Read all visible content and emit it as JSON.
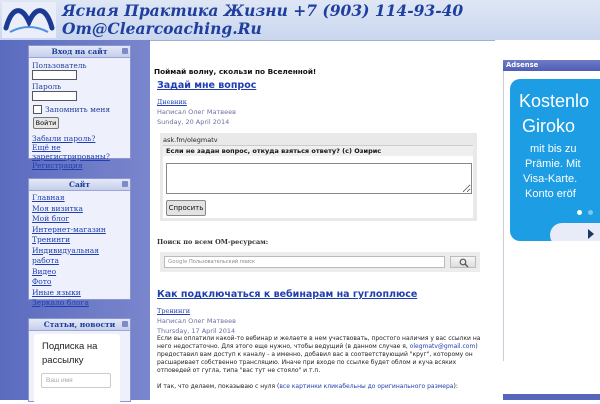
{
  "header": {
    "title_line1": "Ясная Практика Жизни +7 (903) 114-93-40",
    "title_line2": "Om@Clearcoaching.Ru"
  },
  "login": {
    "header": "Вход на сайт",
    "username_label": "Пользователь",
    "password_label": "Пароль",
    "remember_label": "Запомнить меня",
    "submit_label": "Войти",
    "forgot_label": "Забыли пароль?",
    "not_registered_label": "Ещё не зарегистрированы?",
    "register_label": "Регистрация"
  },
  "site_menu": {
    "header": "Сайт",
    "items": [
      "Главная",
      "Моя визитка",
      "Мой блог",
      "Интернет-магазин",
      "Тренинги",
      "Индивидуальная работа",
      "Видео",
      "Фото",
      "Иные языки",
      "Зеркало блога"
    ]
  },
  "news": {
    "header": "Статьи, новости",
    "subscribe_title": "Подписка на рассылку",
    "email_placeholder": "Ваш имя"
  },
  "main": {
    "slogan": "Поймай волну, скользи по Вселенной!",
    "post1": {
      "title": "Задай мне вопрос",
      "category": "Дневник",
      "author": "Написал Олег Матвеев",
      "date": "Sunday, 20 April 2014"
    },
    "ask": {
      "handle": "ask.fm/olegmatv",
      "question": "Если не задан вопрос, откуда взяться ответу? (с) Озирис",
      "button_label": "Спросить"
    },
    "search": {
      "title": "Поиск по всем ОМ-ресурсам:",
      "google_label": "Google",
      "placeholder": "Пользовательский поиск"
    },
    "post2": {
      "title": "Как подключаться к вебинарам на гуглоплюсе",
      "category": "Тренинги",
      "author": "Написал Олег Матвеев",
      "date": "Thursday, 17 April 2014",
      "p1_a": "Если вы оплатили какой-то вебинар и желаете в нем участвовать, простого наличия у вас ссылки на него недостаточно. Для этого еще нужно, чтобы ведущий (в данном случае я,",
      "p1_email": "olegmatv@gmail.com",
      "p1_b": ") предоставил вам доступ к каналу - а именно, добавил вас в соответствующий \"круг\", которому он расшаривает собственно трансляцию. Иначе при входе по ссылке будет облом и куча всяких отповедей от гугла, типа \"вас тут не стояло\" и т.п.",
      "p2_a": "И так, что делаем, показываю с нуля (",
      "p2_link": "все картинки кликабельны до оригинального размера",
      "p2_b": "):"
    }
  },
  "right": {
    "adsense_header": "Adsense",
    "ad": {
      "line1": "Kostenlo",
      "line2": "Giroko",
      "line3": "mit bis zu",
      "line4": "Prämie. Mit",
      "line5": "Visa-Karte.",
      "line6": "Konto eröf"
    }
  },
  "colors": {
    "sidebar": "#5b6bbf",
    "link": "#1f3fb0",
    "ad_blue": "#1d9de3"
  }
}
